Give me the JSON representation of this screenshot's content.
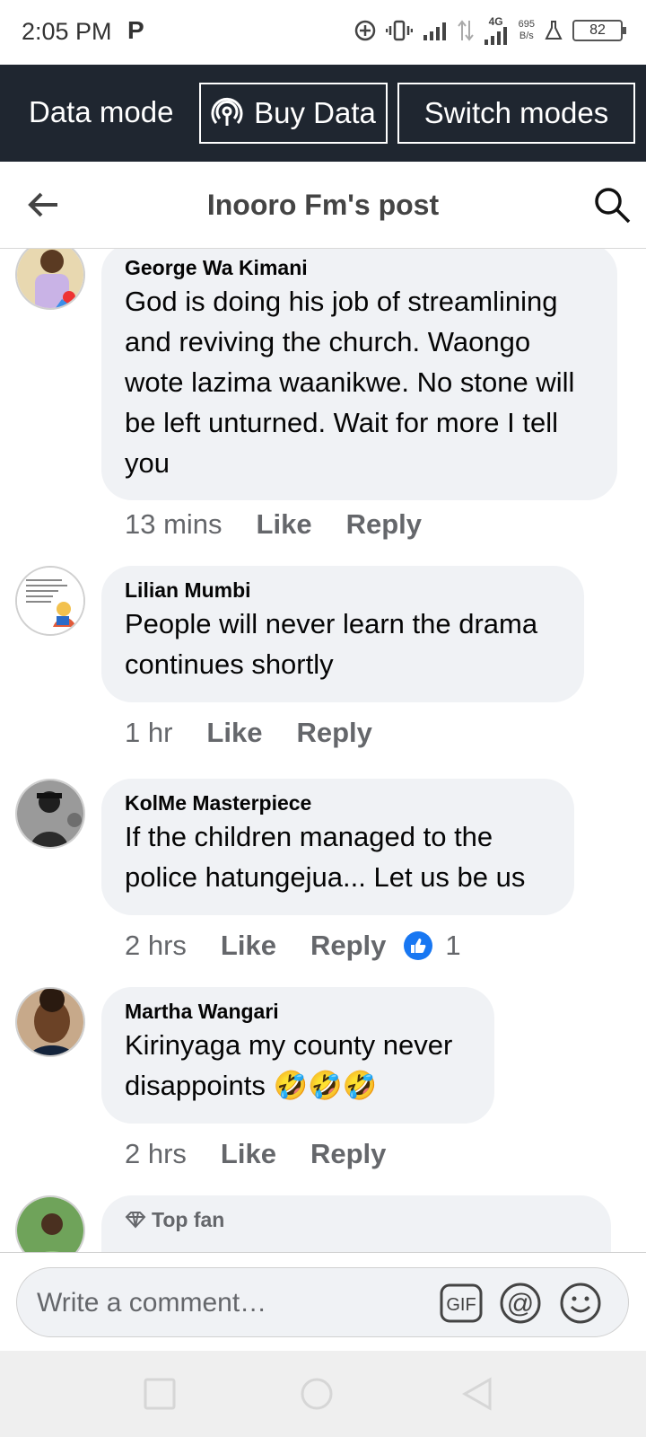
{
  "status_bar": {
    "time": "2:05 PM",
    "p_icon": "P",
    "net_type": "4G",
    "speed_value": "695",
    "speed_unit": "B/s",
    "battery": "82"
  },
  "data_bar": {
    "label": "Data mode",
    "buy_label": "Buy Data",
    "switch_label": "Switch modes"
  },
  "header": {
    "title": "Inooro Fm's post"
  },
  "comments": [
    {
      "author": "George Wa Kimani",
      "text": "God is doing his job of streamlining and reviving the church. Waongo wote lazima waanikwe. No stone will be left unturned. Wait for more I tell you",
      "time": "13 mins",
      "like": "Like",
      "reply": "Reply"
    },
    {
      "author": "Lilian Mumbi",
      "text": "People will never learn the drama continues shortly",
      "time": "1 hr",
      "like": "Like",
      "reply": "Reply"
    },
    {
      "author": "KolMe Masterpiece",
      "text": "If the children managed to the police hatungejua... Let us be us",
      "time": "2 hrs",
      "like": "Like",
      "reply": "Reply",
      "reaction_count": "1"
    },
    {
      "author": "Martha Wangari",
      "text": "Kirinyaga my county never disappoints 🤣🤣🤣",
      "time": "2 hrs",
      "like": "Like",
      "reply": "Reply"
    },
    {
      "badge": "Top fan"
    }
  ],
  "composer": {
    "placeholder": "Write a comment…",
    "gif_label": "GIF",
    "mention_label": "@"
  },
  "colors": {
    "data_bar_bg": "#1f2630",
    "bubble_bg": "#f0f2f5",
    "meta_text": "#65676b",
    "like_blue": "#1877f2"
  }
}
